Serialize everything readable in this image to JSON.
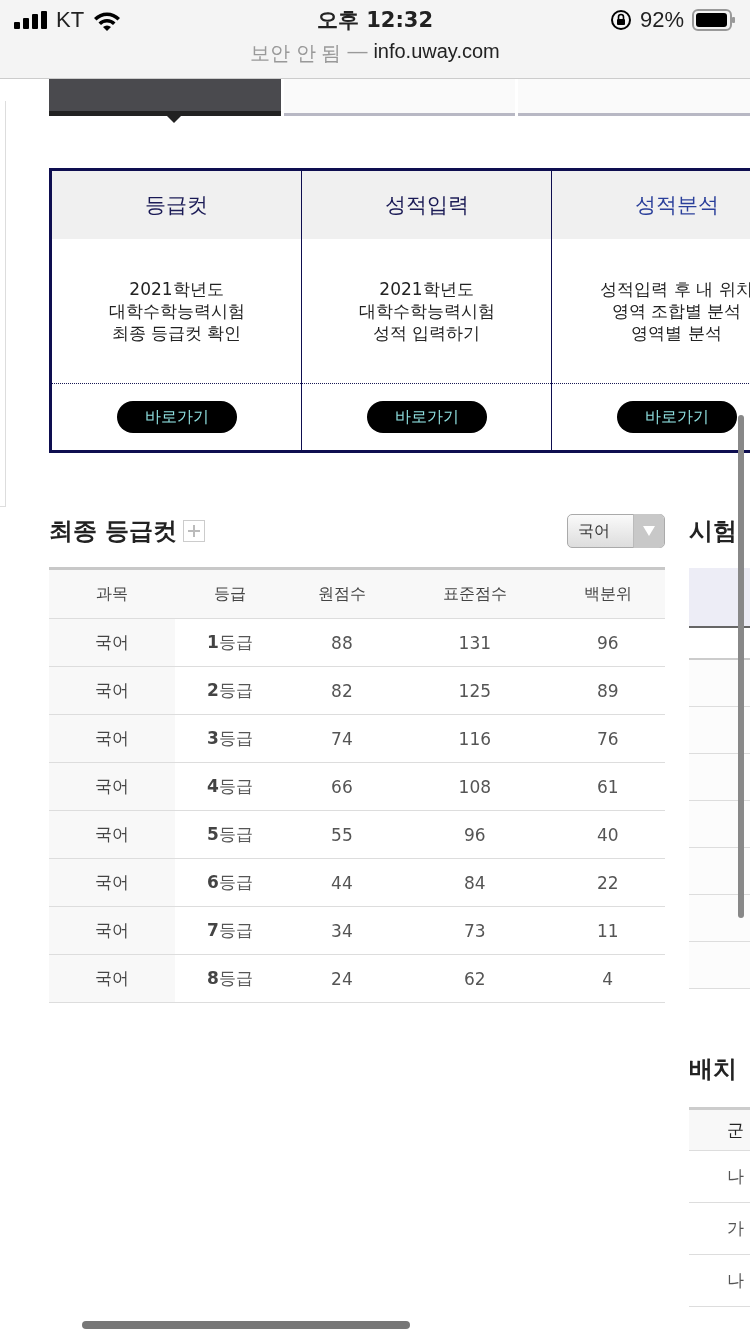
{
  "status_bar": {
    "carrier": "KT",
    "time": "오후 12:32",
    "battery": "92%"
  },
  "address_bar": {
    "security": "보안 안 됨",
    "separator": "—",
    "url": "info.uway.com"
  },
  "tabs": [
    {
      "selected": true
    },
    {
      "selected": false
    },
    {
      "selected": false
    }
  ],
  "cards": [
    {
      "title": "등급컷",
      "lines": [
        "2021학년도",
        "대학수학능력시험",
        "최종 등급컷 확인"
      ],
      "button": "바로가기",
      "selected": false
    },
    {
      "title": "성적입력",
      "lines": [
        "2021학년도",
        "대학수학능력시험",
        "성적 입력하기"
      ],
      "button": "바로가기",
      "selected": false
    },
    {
      "title": "성적분석",
      "lines": [
        "성적입력 후 내 위치",
        "영역 조합별 분석",
        "영역별 분석"
      ],
      "button": "바로가기",
      "selected": true
    }
  ],
  "grade_cut": {
    "title": "최종 등급컷",
    "dropdown": "국어",
    "columns": [
      "과목",
      "등급",
      "원점수",
      "표준점수",
      "백분위"
    ],
    "rows": [
      [
        "국어",
        "**1**등급",
        "88",
        "131",
        "96"
      ],
      [
        "국어",
        "**2**등급",
        "82",
        "125",
        "89"
      ],
      [
        "국어",
        "**3**등급",
        "74",
        "116",
        "76"
      ],
      [
        "국어",
        "**4**등급",
        "66",
        "108",
        "61"
      ],
      [
        "국어",
        "**5**등급",
        "55",
        "96",
        "40"
      ],
      [
        "국어",
        "**6**등급",
        "44",
        "84",
        "22"
      ],
      [
        "국어",
        "**7**등급",
        "34",
        "73",
        "11"
      ],
      [
        "국어",
        "**8**등급",
        "24",
        "62",
        "4"
      ]
    ]
  },
  "side_section": {
    "title": "시험"
  },
  "placement": {
    "title": "배치",
    "columns": [
      "군"
    ],
    "rows": [
      [
        "나"
      ],
      [
        "가"
      ],
      [
        "나"
      ]
    ]
  }
}
